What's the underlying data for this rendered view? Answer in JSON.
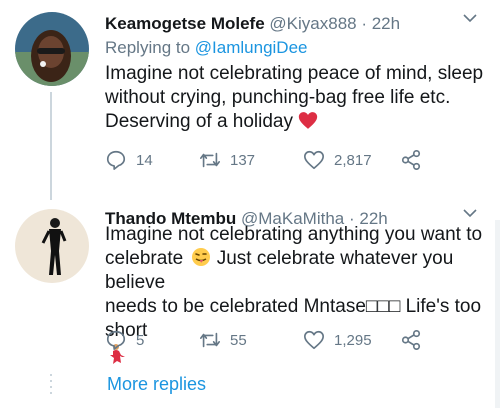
{
  "tweets": [
    {
      "name": "Keamogetse Molefe",
      "handle": "@Kiyax888",
      "time": "· 22h",
      "reply_prefix": "Replying to",
      "reply_mention": "@IamlungiDee",
      "text": "Imagine not celebrating peace of mind, sleep without crying, punching-bag free life etc. Deserving of a holiday",
      "emoji": "red-heart",
      "counts": {
        "replies": "14",
        "retweets": "137",
        "likes": "2,817"
      }
    },
    {
      "name": "Thando Mtembu",
      "handle": "@MaKaMitha",
      "time": "· 22h",
      "text_line1": "Imagine not celebrating anything you want to",
      "text_line2a": "celebrate",
      "text_line2b": " Just celebrate whatever you believe",
      "text_line3": "needs to be celebrated Mntase□□□ Life's too short",
      "emoji": "tongue-wink",
      "counts": {
        "replies": "5",
        "retweets": "55",
        "likes": "1,295"
      }
    }
  ],
  "more_replies": "More replies",
  "colors": {
    "accent": "#1b95e0",
    "muted": "#657786",
    "heart": "#e0245e"
  }
}
